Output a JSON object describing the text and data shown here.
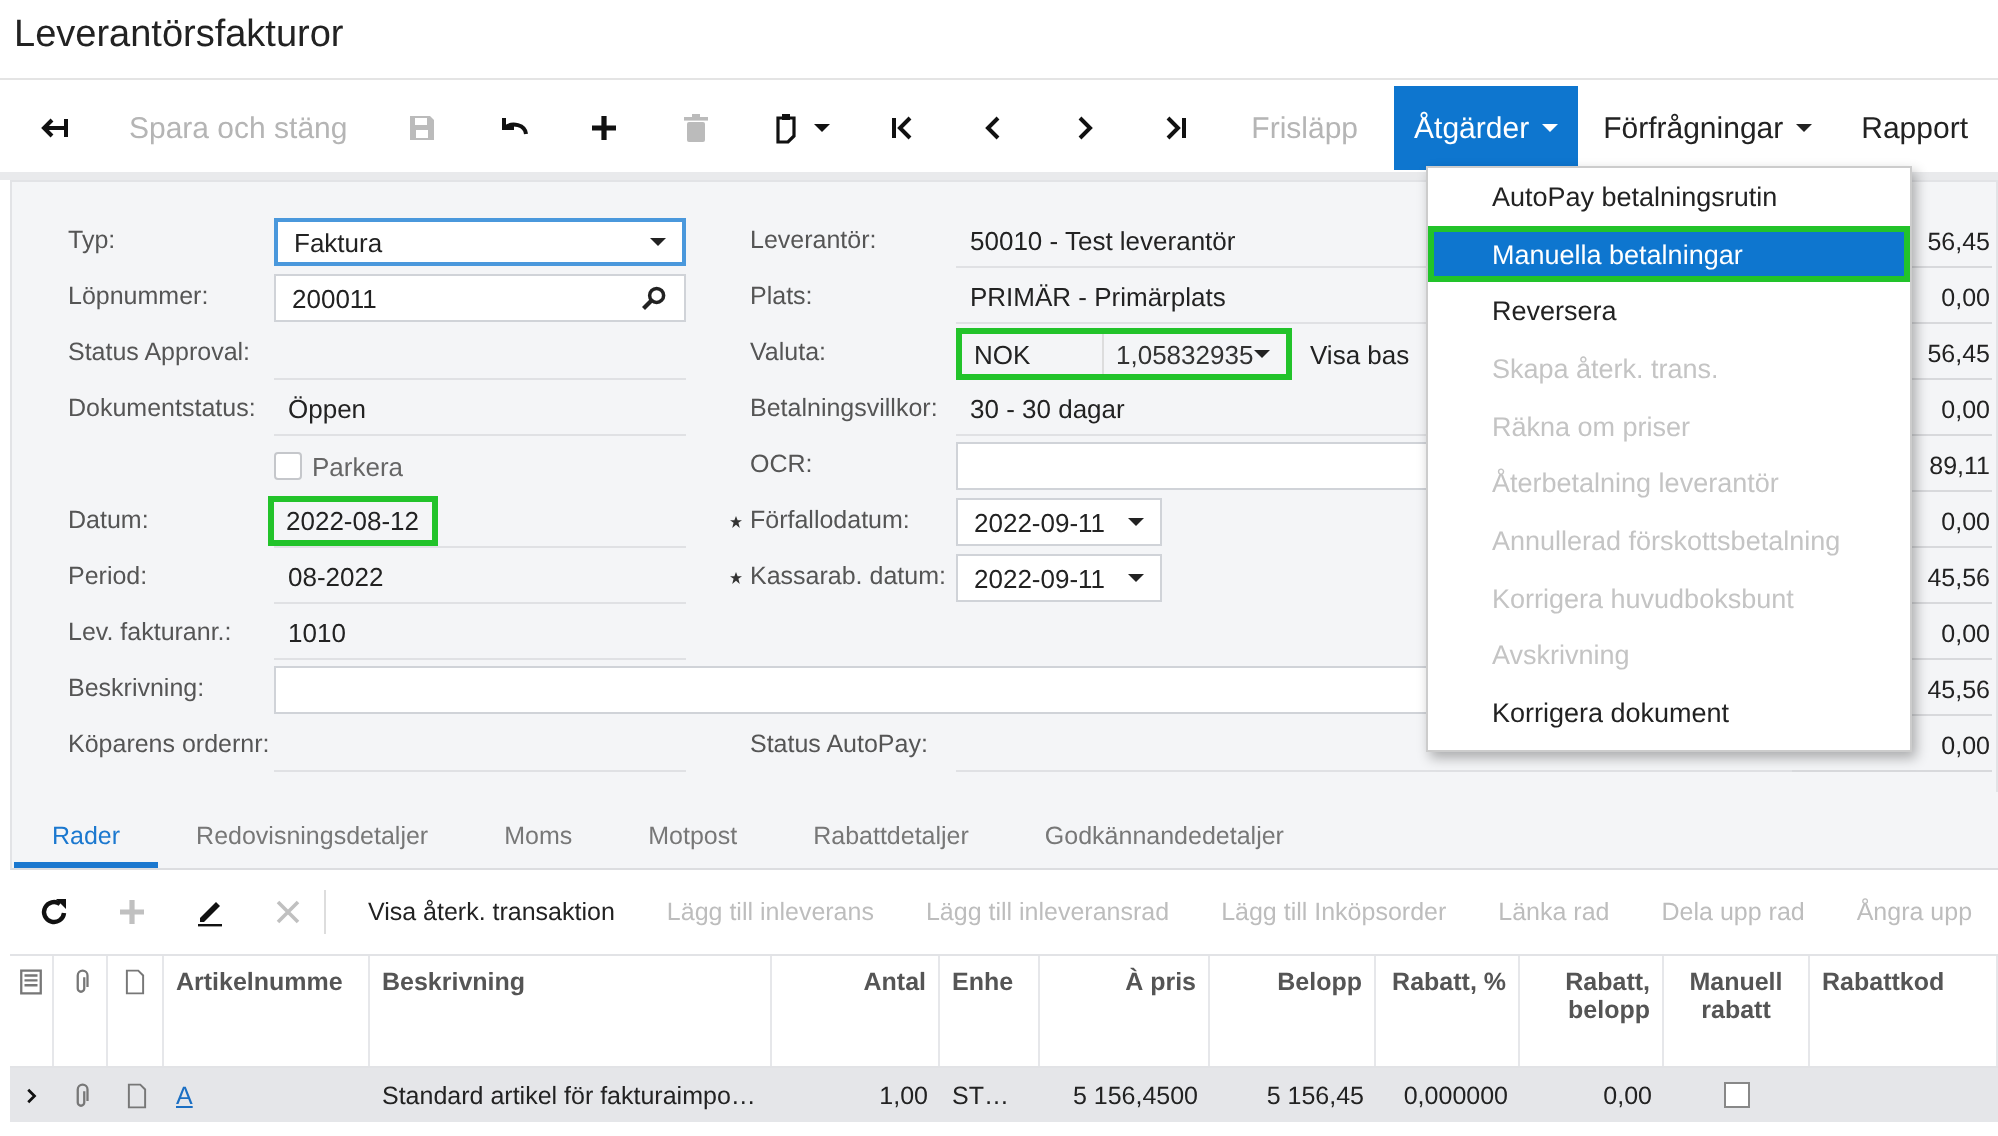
{
  "window": {
    "title": "Leverantörsfakturor"
  },
  "toolbar": [
    {
      "kind": "back",
      "disabled": false
    },
    {
      "kind": "text",
      "label": "Spara och stäng",
      "disabled": true
    },
    {
      "kind": "save",
      "disabled": true
    },
    {
      "kind": "undo",
      "disabled": false
    },
    {
      "kind": "add",
      "disabled": false
    },
    {
      "kind": "delete",
      "disabled": true
    },
    {
      "kind": "clipboard",
      "disabled": false
    },
    {
      "kind": "first",
      "disabled": false
    },
    {
      "kind": "prev",
      "disabled": false
    },
    {
      "kind": "next",
      "disabled": false
    },
    {
      "kind": "last",
      "disabled": false
    },
    {
      "kind": "text",
      "label": "Frisläpp",
      "disabled": true
    },
    {
      "kind": "menu",
      "label": "Åtgärder",
      "open": true
    },
    {
      "kind": "menu",
      "label": "Förfrågningar",
      "open": false
    },
    {
      "kind": "text",
      "label": "Rapport",
      "disabled": false
    }
  ],
  "form": {
    "rows": [
      {
        "label": "Typ:",
        "field": {
          "kind": "select",
          "value": "Faktura",
          "focused": true
        },
        "right": {
          "label": "Leverantör:",
          "required": false,
          "field": {
            "kind": "readonly",
            "value": "50010 - Test leverantör"
          }
        },
        "total": "56,45"
      },
      {
        "label": "Löpnummer:",
        "field": {
          "kind": "lookup",
          "value": "200011"
        },
        "right": {
          "label": "Plats:",
          "required": false,
          "field": {
            "kind": "readonly",
            "value": "PRIMÄR - Primärplats"
          }
        },
        "total": "0,00"
      },
      {
        "label": "Status Approval:",
        "field": {
          "kind": "readonly"
        },
        "right": {
          "label": "Valuta:",
          "required": false,
          "field": {
            "kind": "currency",
            "value": "NOK",
            "rate": "1,05832935",
            "highlighted": true
          },
          "button": "Visa bas"
        },
        "total": "56,45"
      },
      {
        "label": "Dokumentstatus:",
        "field": {
          "kind": "readonly",
          "value": "Öppen"
        },
        "right": {
          "label": "Betalningsvillkor:",
          "required": false,
          "field": {
            "kind": "readonly",
            "value": "30 - 30 dagar"
          }
        },
        "total": "0,00"
      },
      {
        "field": {
          "kind": "checkbox",
          "label": "Parkera",
          "checked": false
        },
        "right": {
          "label": "OCR:",
          "required": false,
          "field": {
            "kind": "input"
          }
        },
        "total": "89,11"
      },
      {
        "label": "Datum:",
        "field": {
          "kind": "readonly",
          "value": "2022-08-12",
          "highlighted": true
        },
        "right": {
          "label": "Förfallodatum:",
          "required": true,
          "field": {
            "kind": "date",
            "value": "2022-09-11"
          }
        },
        "total": "0,00"
      },
      {
        "label": "Period:",
        "field": {
          "kind": "readonly",
          "value": "08-2022"
        },
        "right": {
          "label": "Kassarab. datum:",
          "required": true,
          "field": {
            "kind": "date",
            "value": "2022-09-11"
          }
        },
        "total": "45,56"
      },
      {
        "label": "Lev. fakturanr.:",
        "field": {
          "kind": "readonly",
          "value": "1010"
        },
        "total": "0,00"
      },
      {
        "label": "Beskrivning:",
        "field": {
          "kind": "wide"
        },
        "total": "45,56"
      },
      {
        "label": "Köparens ordernr:",
        "field": {
          "kind": "readonly"
        },
        "right": {
          "label": "Status AutoPay:",
          "required": false,
          "field": {
            "kind": "readonly"
          }
        },
        "total": "0,00"
      }
    ]
  },
  "menu": {
    "items": [
      {
        "label": "AutoPay betalningsrutin",
        "disabled": false,
        "selected": false,
        "highlighted": false
      },
      {
        "label": "Manuella betalningar",
        "disabled": false,
        "selected": true,
        "highlighted": true
      },
      {
        "label": "Reversera",
        "disabled": false,
        "selected": false,
        "highlighted": false
      },
      {
        "label": "Skapa återk. trans.",
        "disabled": true,
        "selected": false,
        "highlighted": false
      },
      {
        "label": "Räkna om priser",
        "disabled": true,
        "selected": false,
        "highlighted": false
      },
      {
        "label": "Återbetalning leverantör",
        "disabled": true,
        "selected": false,
        "highlighted": false
      },
      {
        "label": "Annullerad förskottsbetalning",
        "disabled": true,
        "selected": false,
        "highlighted": false
      },
      {
        "label": "Korrigera huvudboksbunt",
        "disabled": true,
        "selected": false,
        "highlighted": false
      },
      {
        "label": "Avskrivning",
        "disabled": true,
        "selected": false,
        "highlighted": false
      },
      {
        "label": "Korrigera dokument",
        "disabled": false,
        "selected": false,
        "highlighted": false
      }
    ]
  },
  "tabs": [
    {
      "label": "Rader",
      "selected": true
    },
    {
      "label": "Redovisningsdetaljer",
      "selected": false
    },
    {
      "label": "Moms",
      "selected": false
    },
    {
      "label": "Motpost",
      "selected": false
    },
    {
      "label": "Rabattdetaljer",
      "selected": false
    },
    {
      "label": "Godkännandedetaljer",
      "selected": false
    }
  ],
  "grid_toolbar": [
    {
      "kind": "refresh",
      "disabled": false
    },
    {
      "kind": "add",
      "disabled": true
    },
    {
      "kind": "edit",
      "disabled": false
    },
    {
      "kind": "delete",
      "disabled": true
    },
    {
      "kind": "separator"
    },
    {
      "kind": "text",
      "label": "Visa återk. transaktion",
      "disabled": false
    },
    {
      "kind": "text",
      "label": "Lägg till inleverans",
      "disabled": true
    },
    {
      "kind": "text",
      "label": "Lägg till inleveransrad",
      "disabled": true
    },
    {
      "kind": "text",
      "label": "Lägg till Inköpsorder",
      "disabled": true
    },
    {
      "kind": "text",
      "label": "Länka rad",
      "disabled": true
    },
    {
      "kind": "text",
      "label": "Dela upp rad",
      "disabled": true
    },
    {
      "kind": "text",
      "label": "Ångra upp",
      "disabled": true
    }
  ],
  "table": {
    "columns": [
      {
        "kind": "icon-list"
      },
      {
        "kind": "icon-clip"
      },
      {
        "kind": "icon-file"
      },
      {
        "kind": "text",
        "label": "Artikelnumme"
      },
      {
        "kind": "text",
        "label": "Beskrivning"
      },
      {
        "kind": "num",
        "label": "Antal"
      },
      {
        "kind": "text",
        "label": "Enhe"
      },
      {
        "kind": "num",
        "label": "À pris"
      },
      {
        "kind": "num",
        "label": "Belopp"
      },
      {
        "kind": "num",
        "label": "Rabatt, %"
      },
      {
        "kind": "num",
        "label": "Rabatt, belopp"
      },
      {
        "kind": "check",
        "label": "Manuell rabatt"
      },
      {
        "kind": "text",
        "label": "Rabattkod"
      }
    ],
    "rows": [
      {
        "selected": true,
        "item": "A",
        "description": "Standard artikel för fakturaimpo…",
        "quantity": "1,00",
        "unit": "ST…",
        "unit_price": "5 156,4500",
        "amount": "5 156,45",
        "discount_percent": "0,000000",
        "discount_amount": "0,00",
        "manual_discount": false
      }
    ]
  }
}
